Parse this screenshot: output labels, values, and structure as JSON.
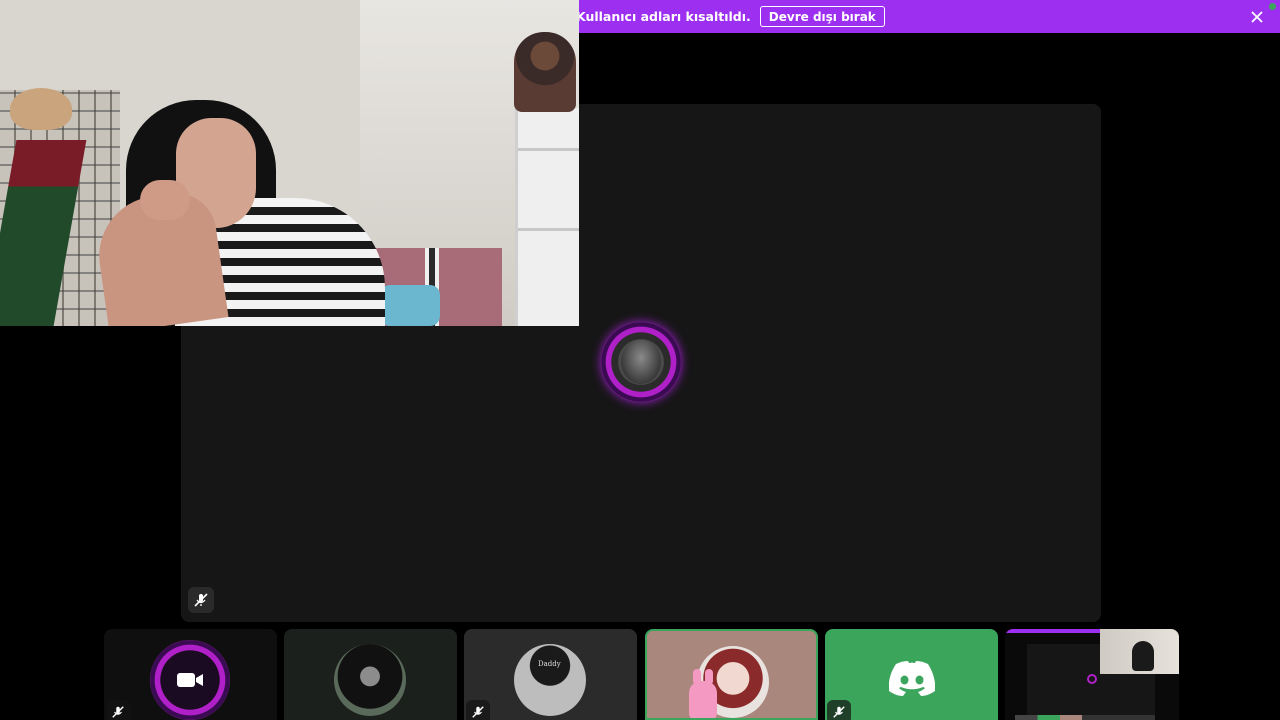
{
  "notice_bar": {
    "message": "Kullanıcı adları kısaltıldı.",
    "disable_button": "Devre dışı bırak",
    "close_icon": "close-icon",
    "accent_color": "#9d2ff0"
  },
  "stage": {
    "background": "#161616",
    "avatar_icon": "profile-avatar",
    "mute_icon": "mic-muted-icon"
  },
  "camera_window": {
    "content": "live-camera-video"
  },
  "participants": [
    {
      "kind": "avatar-ring",
      "icon": "video-camera-icon",
      "muted": true
    },
    {
      "kind": "avatar",
      "muted": false
    },
    {
      "kind": "avatar",
      "cap_text": "Daddy",
      "muted": true
    },
    {
      "kind": "avatar",
      "speaking": true,
      "muted": false
    },
    {
      "kind": "app",
      "icon": "discord-logo-icon",
      "muted": true,
      "background": "#3ba55c"
    },
    {
      "kind": "screen-share-preview",
      "muted": false
    }
  ],
  "colors": {
    "speaking_border": "#3ba55c",
    "tile_dark": "#161616"
  }
}
